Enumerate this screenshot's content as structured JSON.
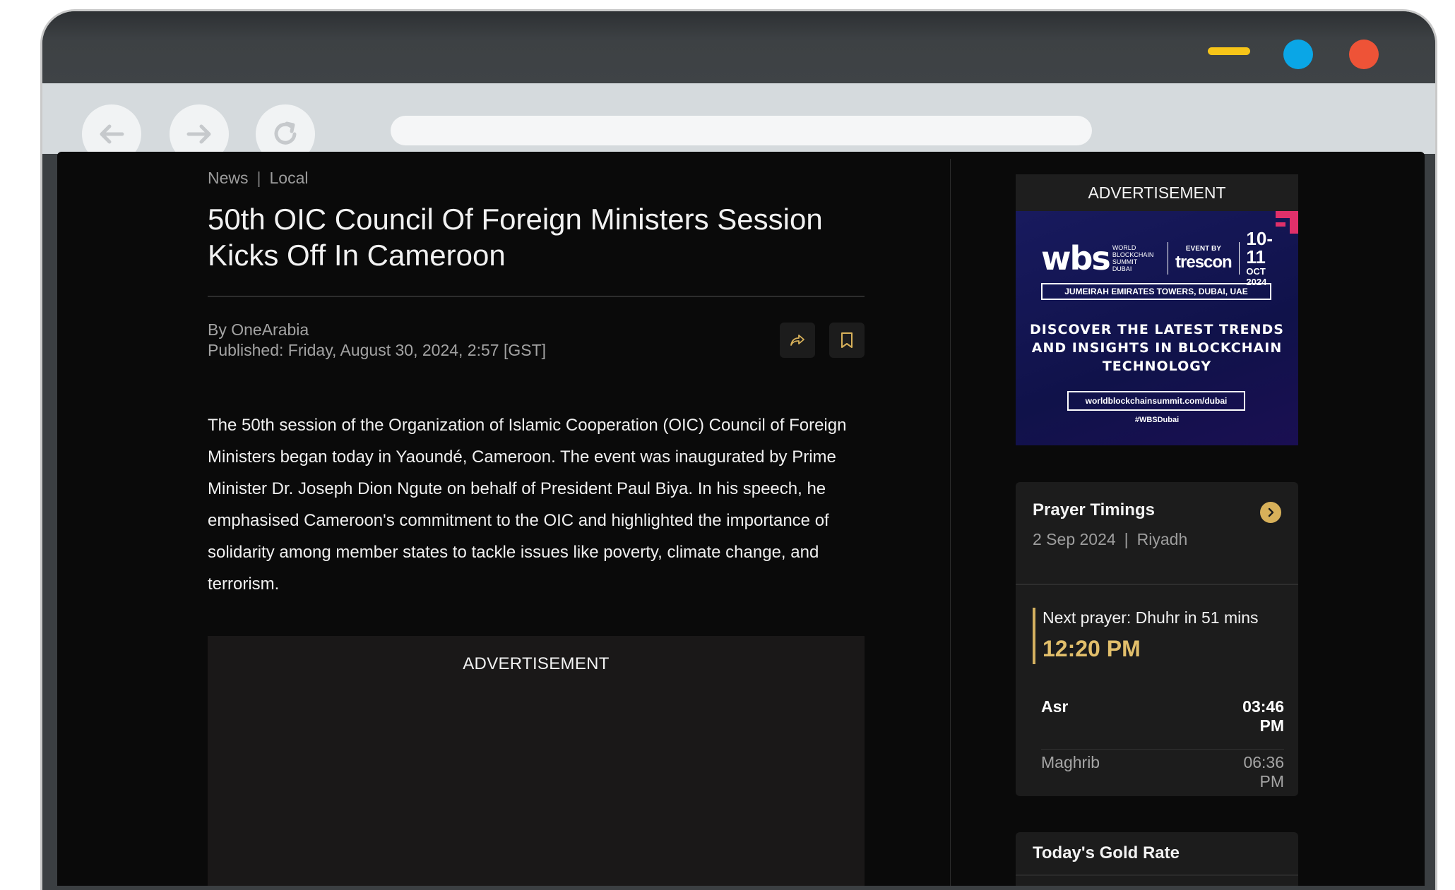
{
  "article": {
    "breadcrumb": {
      "section": "News",
      "separator": "|",
      "subsection": "Local"
    },
    "headline": "50th OIC Council Of Foreign Ministers Session Kicks Off In Cameroon",
    "byline": "By OneArabia",
    "published": "Published: Friday, August 30, 2024, 2:57 [GST]",
    "body": "The 50th session of the Organization of Islamic Cooperation (OIC) Council of Foreign Ministers began today in Yaoundé, Cameroon. The event was inaugurated by Prime Minister Dr. Joseph Dion Ngute on behalf of President Paul Biya. In his speech, he emphasised Cameroon's commitment to the OIC and highlighted the importance of solidarity among member states to tackle issues like poverty, climate change, and terrorism.",
    "ad_label": "ADVERTISEMENT"
  },
  "sidebar": {
    "ad_label": "ADVERTISEMENT",
    "banner": {
      "logo": "wbs",
      "logo_small": "WORLD BLOCKCHAIN SUMMIT",
      "logo_city": "DUBAI",
      "event_by": "EVENT BY",
      "organizer": "trescon",
      "dates": "10-11",
      "month": "OCT 2024",
      "venue": "JUMEIRAH EMIRATES TOWERS, DUBAI, UAE",
      "headline": "DISCOVER THE LATEST TRENDS AND INSIGHTS IN BLOCKCHAIN TECHNOLOGY",
      "url": "worldblockchainsummit.com/dubai",
      "hashtag": "#WBSDubai"
    },
    "prayer": {
      "title": "Prayer Timings",
      "date": "2 Sep 2024",
      "separator": "|",
      "city": "Riyadh",
      "next_label": "Next prayer: Dhuhr in 51 mins",
      "next_time": "12:20 PM",
      "rows": [
        {
          "name": "Asr",
          "time_a": "03:46",
          "time_b": "PM"
        },
        {
          "name": "Maghrib",
          "time_a": "06:36",
          "time_b": "PM"
        }
      ]
    },
    "gold": {
      "title": "Today's Gold Rate"
    }
  },
  "colors": {
    "accent_gold": "#d8b15a",
    "page_bg": "#0a0a0a",
    "window_min": "#f7c518",
    "window_max": "#0aa6e6",
    "window_close": "#ee5337"
  },
  "icons": {
    "back": "arrow-left-icon",
    "forward": "arrow-right-icon",
    "reload": "reload-icon",
    "share": "share-icon",
    "bookmark": "bookmark-icon",
    "prayer_arrow": "chevron-right-icon"
  }
}
